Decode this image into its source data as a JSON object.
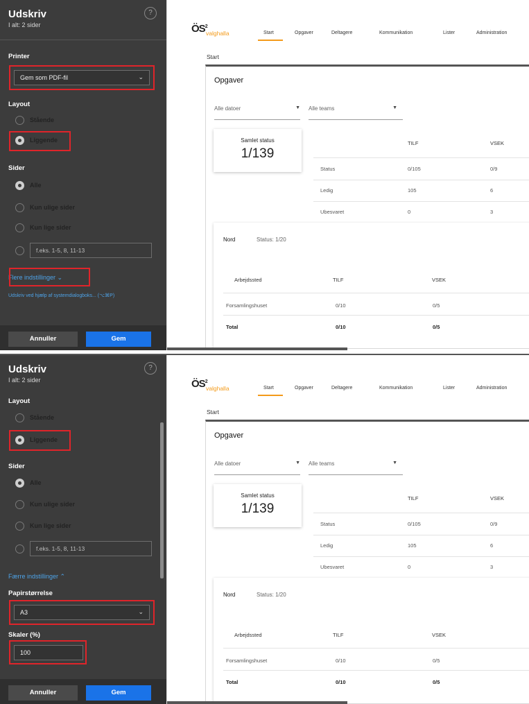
{
  "dialog": {
    "title": "Udskriv",
    "subtitle": "I alt: 2 sider",
    "help_icon": "?",
    "printer_label": "Printer",
    "printer_value": "Gem som PDF-fil",
    "layout_label": "Layout",
    "layout_portrait": "Stående",
    "layout_landscape": "Liggende",
    "pages_label": "Sider",
    "pages_all": "Alle",
    "pages_odd": "Kun ulige sider",
    "pages_even": "Kun lige sider",
    "pages_custom_placeholder": "f.eks. 1-5, 8, 11-13",
    "more_settings": "Flere indstillinger ⌄",
    "fewer_settings": "Færre indstillinger ⌃",
    "system_dialog": "Udskriv ved hjælp af systemdialogboks... (⌥⌘P)",
    "paper_size_label": "Papirstørrelse",
    "paper_size_value": "A3",
    "scale_label": "Skaler (%)",
    "scale_value": "100",
    "cancel": "Annuller",
    "save": "Gem"
  },
  "web": {
    "logo": "ÖS",
    "logo_super": "2",
    "logo_sub": "valghalla",
    "tabs": [
      "Start",
      "Opgaver",
      "Deltagere",
      "Kommunikation",
      "Lister",
      "Administration"
    ],
    "breadcrumb": "Start",
    "card_title": "Opgaver",
    "filter_dates": "Alle datoer",
    "filter_teams": "Alle teams",
    "status_label": "Samlet status",
    "status_value": "1/139",
    "summary_headers": [
      "TILF",
      "VSEK"
    ],
    "summary_rows": [
      {
        "label": "Status",
        "tilf": "0/105",
        "vsek": "0/9"
      },
      {
        "label": "Ledig",
        "tilf": "105",
        "vsek": "6"
      },
      {
        "label": "Ubesvaret",
        "tilf": "0",
        "vsek": "3"
      }
    ],
    "nord_title": "Nord",
    "nord_status": "Status: 1/20",
    "nord_headers": [
      "Arbejdssted",
      "TILF",
      "VSEK"
    ],
    "nord_rows": [
      {
        "place": "Forsamlingshuset",
        "tilf": "0/10",
        "vsek": "0/5"
      },
      {
        "place": "Total",
        "tilf": "0/10",
        "vsek": "0/5"
      }
    ]
  },
  "colors": {
    "dialog_bg": "#3c3c3c",
    "highlight": "#e0242a",
    "link": "#4ea3e8",
    "save_button": "#1a73e8",
    "brand_orange": "#f39a1a"
  }
}
